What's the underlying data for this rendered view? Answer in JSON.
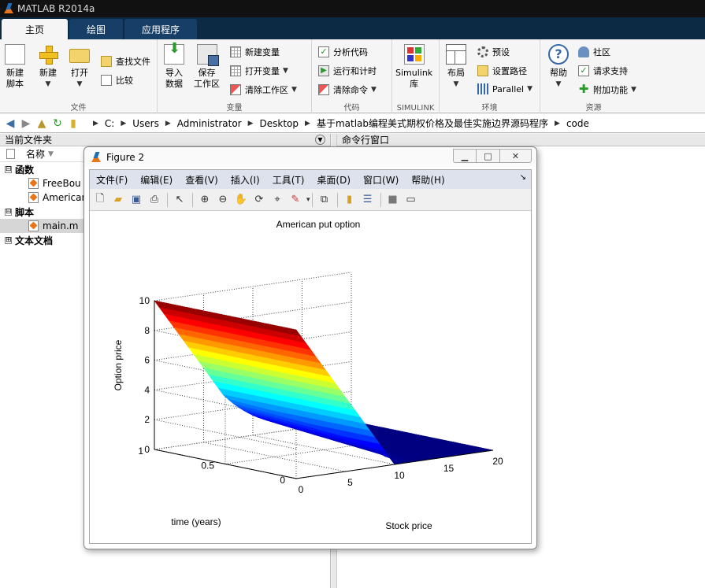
{
  "app": {
    "title": "MATLAB R2014a"
  },
  "ribbon": {
    "tabs": [
      "主页",
      "绘图",
      "应用程序"
    ],
    "groups": {
      "file": {
        "label": "文件",
        "new_script": "新建\n脚本",
        "new": "新建",
        "open": "打开",
        "find_files": "查找文件",
        "compare": "比较"
      },
      "variable": {
        "label": "变量",
        "import": "导入\n数据",
        "save_ws": "保存\n工作区",
        "new_var": "新建变量",
        "open_var": "打开变量",
        "clear_ws": "清除工作区"
      },
      "code": {
        "label": "代码",
        "analyze": "分析代码",
        "run_time": "运行和计时",
        "clear_cmds": "清除命令"
      },
      "simulink": {
        "label": "SIMULINK",
        "library": "Simulink\n库"
      },
      "environment": {
        "label": "环境",
        "layout": "布局",
        "preferences": "预设",
        "set_path": "设置路径",
        "parallel": "Parallel"
      },
      "resources": {
        "label": "资源",
        "help": "帮助",
        "community": "社区",
        "request_support": "请求支持",
        "addons": "附加功能"
      }
    }
  },
  "address": {
    "path": [
      "C:",
      "Users",
      "Administrator",
      "Desktop",
      "基于matlab编程美式期权价格及最佳实施边界源码程序",
      "code"
    ]
  },
  "current_folder": {
    "title": "当前文件夹",
    "col_name": "名称",
    "groups": [
      {
        "label": "函数",
        "expander": "⊟",
        "items": [
          "FreeBou",
          "American"
        ]
      },
      {
        "label": "脚本",
        "expander": "⊟",
        "items": [
          "main.m"
        ]
      },
      {
        "label": "文本文档",
        "expander": "⊞",
        "items": []
      }
    ]
  },
  "command_window": {
    "title": "命令行窗口"
  },
  "figure": {
    "title": "Figure 2",
    "menus": [
      "文件(F)",
      "编辑(E)",
      "查看(V)",
      "插入(I)",
      "工具(T)",
      "桌面(D)",
      "窗口(W)",
      "帮助(H)"
    ]
  },
  "chart_data": {
    "type": "surface",
    "title": "American put option",
    "xlabel": "Stock price",
    "ylabel": "time (years)",
    "zlabel": "Option price",
    "xlim": [
      0,
      20
    ],
    "ylim": [
      0,
      1
    ],
    "zlim": [
      0,
      10
    ],
    "xticks": [
      "0",
      "5",
      "10",
      "15",
      "20"
    ],
    "yticks": [
      "0",
      "0.5",
      "1"
    ],
    "zticks": [
      "0",
      "2",
      "4",
      "6",
      "8",
      "10"
    ],
    "strike": 10,
    "grid": "on",
    "colormap": "jet",
    "surface": "American put value V(S,t): at t=0 payoff max(10-S,0); at t=1 value 10 at S=0 decaying smoothly to 0 at S=20"
  }
}
